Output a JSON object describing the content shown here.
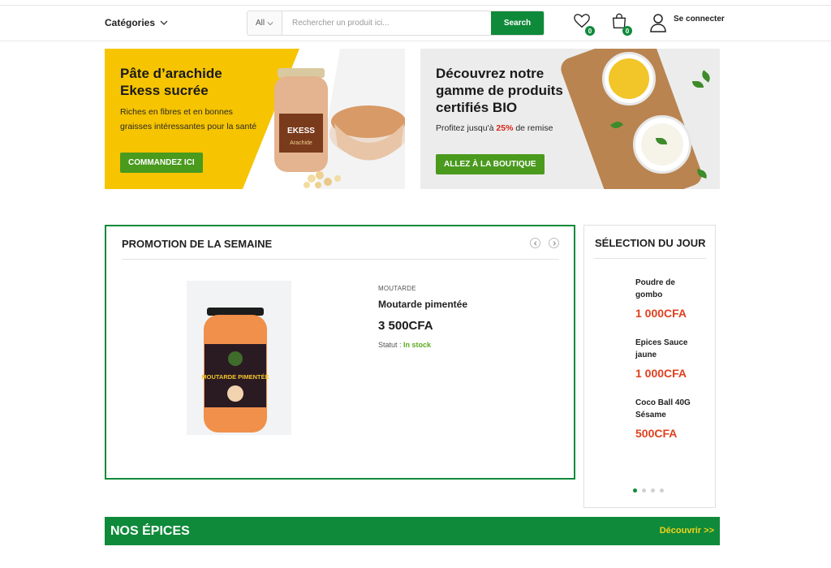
{
  "header": {
    "categories_label": "Catégories",
    "search": {
      "category": "All",
      "placeholder": "Rechercher un produit ici...",
      "button": "Search"
    },
    "wishlist_count": "0",
    "cart_count": "0",
    "login_label": "Se connecter"
  },
  "banners": [
    {
      "title_line1": "Pâte d’arachide",
      "title_line2": "Ekess sucrée",
      "text_line1": "Riches en fibres et en bonnes",
      "text_line2": "graisses intéressantes pour la santé",
      "button": "COMMANDEZ ICI",
      "label_jar_brand": "EKESS",
      "label_jar_sub": "Arachide"
    },
    {
      "title_line1": "Découvrez notre",
      "title_line2": "gamme de produits",
      "title_line3": "certifiés BIO",
      "text_prefix": "Profitez jusqu'à ",
      "text_percent": "25%",
      "text_suffix": " de remise",
      "button": "ALLEZ À LA BOUTIQUE"
    }
  ],
  "promotion": {
    "title": "PROMOTION DE LA SEMAINE",
    "product": {
      "category": "MOUTARDE",
      "name": "Moutarde pimentée",
      "price": "3 500CFA",
      "status_label": "Statut : ",
      "status_value": "In stock",
      "jar_label": "MOUTARDE PIMENTÉE"
    }
  },
  "selection": {
    "title": "SÉLECTION DU JOUR",
    "items": [
      {
        "name_line1": "Poudre de",
        "name_line2": "gombo",
        "price": "1 000CFA"
      },
      {
        "name_line1": "Epices Sauce",
        "name_line2": "jaune",
        "price": "1 000CFA"
      },
      {
        "name_line1": "Coco Ball 40G",
        "name_line2": "Sésame",
        "price": "500CFA"
      }
    ]
  },
  "epices": {
    "title": "NOS ÉPICES",
    "link": "Découvrir >>"
  },
  "colors": {
    "brand_green": "#0f8a3a",
    "banner_yellow": "#f6c400",
    "button_green": "#4a9a1e",
    "price_red": "#e0401f",
    "link_yellow": "#f4d21a"
  }
}
